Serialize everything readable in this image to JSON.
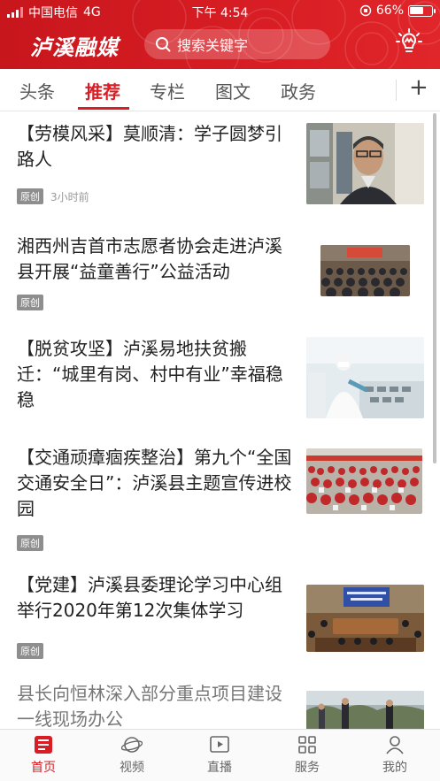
{
  "status_bar": {
    "carrier": "中国电信",
    "network": "4G",
    "time": "下午 4:54",
    "battery": "66%",
    "battery_level": 0.66
  },
  "header": {
    "logo": "泸溪融媒",
    "search_placeholder": "搜索关键字"
  },
  "tabs": [
    {
      "label": "头条",
      "active": false
    },
    {
      "label": "推荐",
      "active": true
    },
    {
      "label": "专栏",
      "active": false
    },
    {
      "label": "图文",
      "active": false
    },
    {
      "label": "政务",
      "active": false
    }
  ],
  "articles": [
    {
      "title": "【劳模风采】莫顺清：学子圆梦引路人",
      "badge": "原创",
      "time": "3小时前"
    },
    {
      "title": "湘西州吉首市志愿者协会走进泸溪县开展“益童善行”公益活动",
      "badge": "原创",
      "time": ""
    },
    {
      "title": "【脱贫攻坚】泸溪易地扶贫搬迁：“城里有岗、村中有业”幸福稳稳",
      "badge": "",
      "time": ""
    },
    {
      "title": "【交通顽瘴痼疾整治】第九个“全国交通安全日”：泸溪县主题宣传进校园",
      "badge": "原创",
      "time": ""
    },
    {
      "title": "【党建】泸溪县委理论学习中心组举行2020年第12次集体学习",
      "badge": "原创",
      "time": ""
    },
    {
      "title": "县长向恒林深入部分重点项目建设一线现场办公",
      "badge": "",
      "time": ""
    }
  ],
  "bottom_nav": [
    {
      "label": "首页",
      "icon": "home-icon",
      "active": true
    },
    {
      "label": "视频",
      "icon": "planet-icon",
      "active": false
    },
    {
      "label": "直播",
      "icon": "play-icon",
      "active": false
    },
    {
      "label": "服务",
      "icon": "grid-icon",
      "active": false
    },
    {
      "label": "我的",
      "icon": "user-icon",
      "active": false
    }
  ],
  "colors": {
    "brand": "#d81e24",
    "badge": "#8e8e8e"
  }
}
